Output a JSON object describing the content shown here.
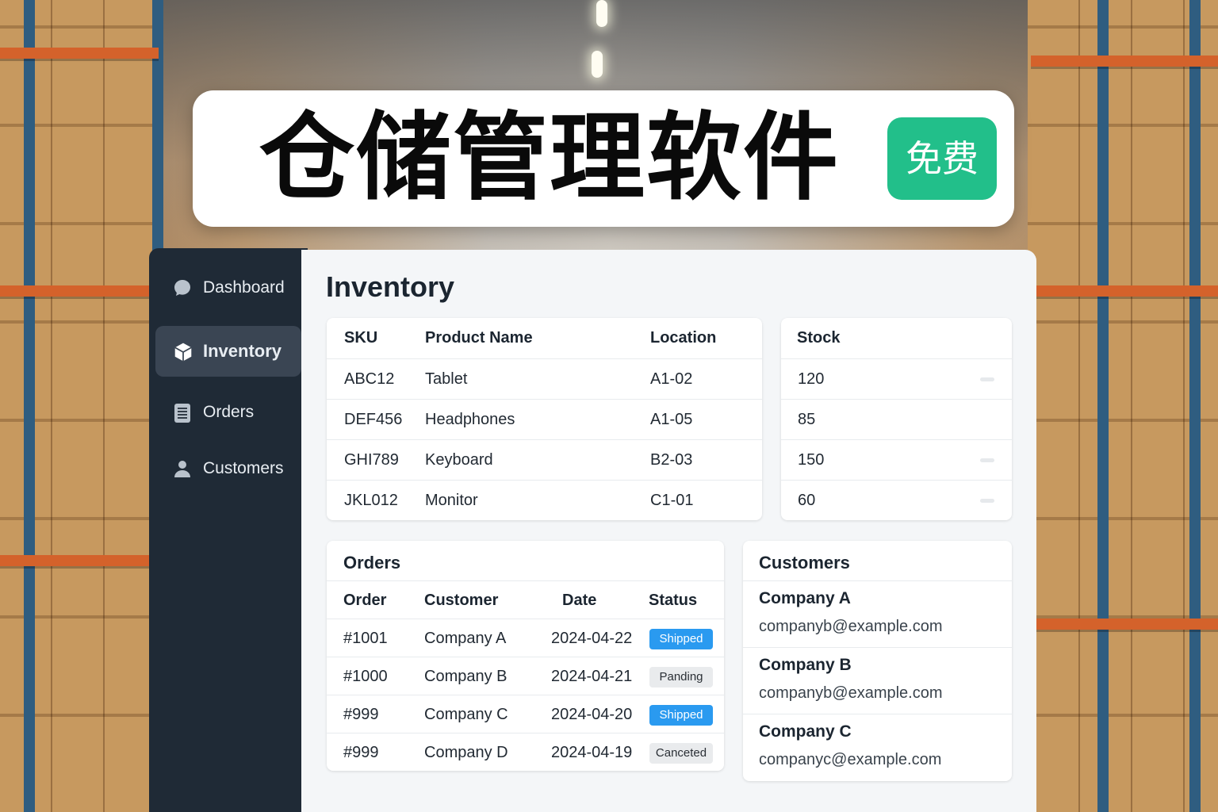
{
  "banner": {
    "title": "仓储管理软件",
    "badge": "免费"
  },
  "sidebar": {
    "items": [
      {
        "label": "Dashboard",
        "icon": "chat-bubble-icon",
        "active": false
      },
      {
        "label": "Inventory",
        "icon": "cube-icon",
        "active": true
      },
      {
        "label": "Orders",
        "icon": "document-list-icon",
        "active": false
      },
      {
        "label": "Customers",
        "icon": "user-icon",
        "active": false
      }
    ]
  },
  "main": {
    "title": "Inventory"
  },
  "inventory": {
    "headers": {
      "sku": "SKU",
      "product": "Product Name",
      "location": "Location",
      "stock": "Stock"
    },
    "rows": [
      {
        "sku": "ABC12",
        "product": "Tablet",
        "location": "A1-02",
        "stock": "120"
      },
      {
        "sku": "DEF456",
        "product": "Headphones",
        "location": "A1-05",
        "stock": "85"
      },
      {
        "sku": "GHI789",
        "product": "Keyboard",
        "location": "B2-03",
        "stock": "150"
      },
      {
        "sku": "JKL012",
        "product": "Monitor",
        "location": "C1-01",
        "stock": "60"
      }
    ]
  },
  "orders": {
    "title": "Orders",
    "headers": {
      "order": "Order",
      "customer": "Customer",
      "date": "Date",
      "status": "Status"
    },
    "rows": [
      {
        "order": "#1001",
        "customer": "Company A",
        "date": "2024-04-22",
        "status": "Shipped",
        "status_color": "#2a9af0"
      },
      {
        "order": "#1000",
        "customer": "Company B",
        "date": "2024-04-21",
        "status": "Panding",
        "status_color": "#e9ebed"
      },
      {
        "order": "#999",
        "customer": "Company C",
        "date": "2024-04-20",
        "status": "Shipped",
        "status_color": "#2a9af0"
      },
      {
        "order": "#999",
        "customer": "Company D",
        "date": "2024-04-19",
        "status": "Canceted",
        "status_color": "#e9ebed"
      }
    ]
  },
  "customers": {
    "title": "Customers",
    "items": [
      {
        "name": "Company A",
        "email": "companyb@example.com"
      },
      {
        "name": "Company B",
        "email": "companyb@example.com"
      },
      {
        "name": "Company C",
        "email": "companyc@example.com"
      }
    ]
  },
  "colors": {
    "badge_green": "#22bf8a",
    "sidebar_bg": "#1f2a36",
    "sidebar_active": "#3a4553",
    "shipped_blue": "#2a9af0",
    "shelf_orange": "#d4622b",
    "shelf_blue": "#2f5d80"
  }
}
